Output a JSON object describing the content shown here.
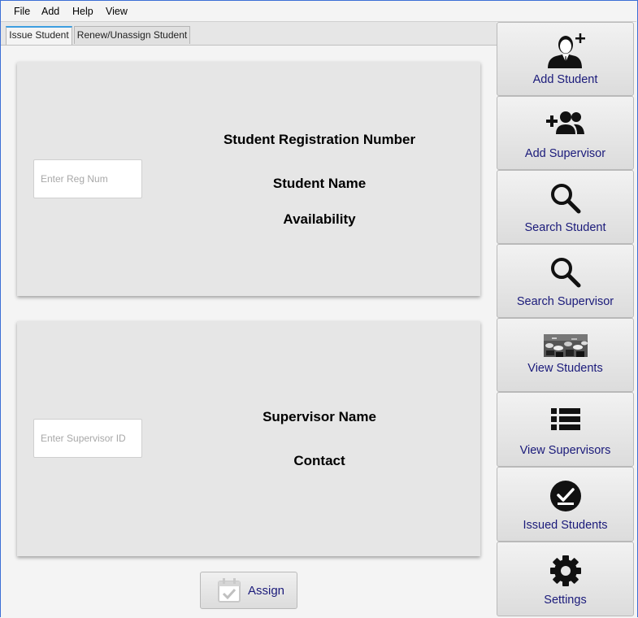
{
  "menu": [
    "File",
    "Add",
    "Help",
    "View"
  ],
  "tabs": [
    "Issue Student",
    "Renew/Unassign Student"
  ],
  "student_card": {
    "reg_placeholder": "Enter Reg Num",
    "reg_number_label": "Student Registration Number",
    "name_label": "Student Name",
    "availability_label": "Availability"
  },
  "supervisor_card": {
    "id_placeholder": "Enter Supervisor ID",
    "name_label": "Supervisor Name",
    "contact_label": "Contact"
  },
  "assign_label": "Assign",
  "sidebar": [
    {
      "label": "Add Student",
      "icon": "add-student-icon"
    },
    {
      "label": "Add Supervisor",
      "icon": "add-supervisor-icon"
    },
    {
      "label": "Search Student",
      "icon": "search-icon"
    },
    {
      "label": "Search Supervisor",
      "icon": "search-icon"
    },
    {
      "label": "View Students",
      "icon": "graduates-photo-icon"
    },
    {
      "label": "View Supervisors",
      "icon": "list-icon"
    },
    {
      "label": "Issued Students",
      "icon": "check-circle-icon"
    },
    {
      "label": "Settings",
      "icon": "gear-icon"
    }
  ],
  "colors": {
    "sidebar_label": "#1a1a7a",
    "active_tab_accent": "#3c9ee0"
  }
}
